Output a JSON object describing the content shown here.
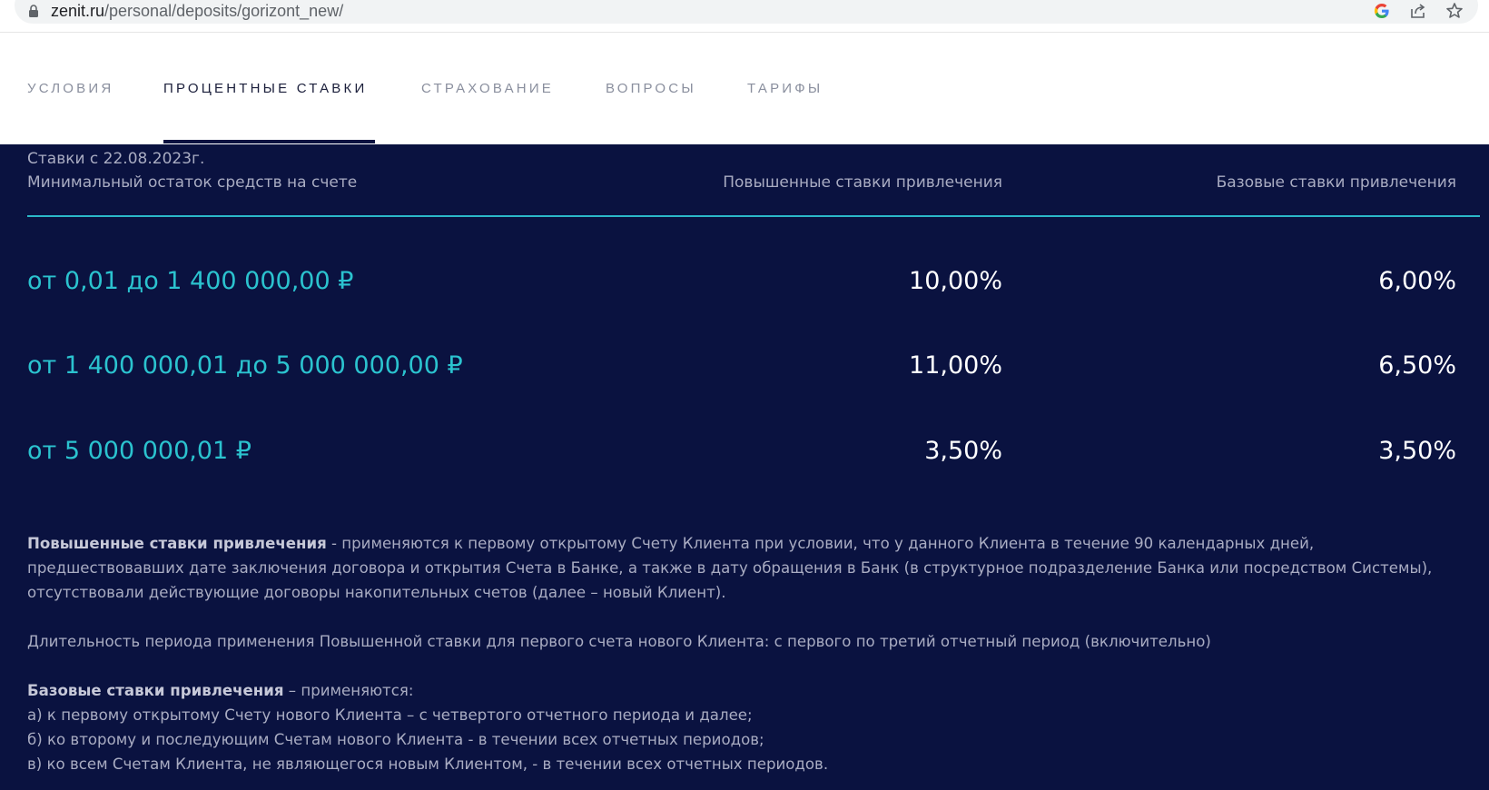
{
  "browser": {
    "url_host": "zenit.ru",
    "url_path": "/personal/deposits/gorizont_new/",
    "icons": [
      "lock-icon",
      "google-icon",
      "share-icon",
      "star-icon"
    ]
  },
  "tabs": [
    {
      "label": "УСЛОВИЯ",
      "active": false
    },
    {
      "label": "ПРОЦЕНТНЫЕ СТАВКИ",
      "active": true
    },
    {
      "label": "СТРАХОВАНИЕ",
      "active": false
    },
    {
      "label": "ВОПРОСЫ",
      "active": false
    },
    {
      "label": "ТАРИФЫ",
      "active": false
    }
  ],
  "rates": {
    "date_note": "Ставки с 22.08.2023г.",
    "columns": [
      "Минимальный остаток средств на счете",
      "Повышенные ставки привлечения",
      "Базовые ставки привлечения"
    ],
    "rows": [
      {
        "range": "от 0,01 до 1 400 000,00 ₽",
        "high": "10,00%",
        "base": "6,00%"
      },
      {
        "range": "от 1 400 000,01 до 5 000 000,00 ₽",
        "high": "11,00%",
        "base": "6,50%"
      },
      {
        "range": "от 5 000 000,01 ₽",
        "high": "3,50%",
        "base": "3,50%"
      }
    ]
  },
  "notes": {
    "p1_bold": "Повышенные ставки привлечения",
    "p1_text": " - применяются к первому открытому Счету Клиента при условии, что у данного Клиента в течение 90 календарных дней, предшествовавших дате заключения договора и открытия Счета в Банке, а также в дату обращения в Банк (в структурное подразделение Банка или посредством Системы), отсутствовали действующие договоры накопительных счетов (далее – новый Клиент).",
    "p2_text": "Длительность периода применения Повышенной ставки для первого счета нового Клиента: с первого по третий отчетный период (включительно)",
    "p3_bold": "Базовые ставки привлечения",
    "p3_text": " – применяются:",
    "p3_items": [
      "а) к первому открытому Счету нового Клиента – с четвертого отчетного периода и далее;",
      "б) ко второму и последующим Счетам нового Клиента - в течении всех отчетных периодов;",
      "в) ко всем Счетам Клиента, не являющегося новым Клиентом, - в течении всех отчетных периодов."
    ]
  },
  "colors": {
    "background_dark": "#0a1240",
    "accent_teal": "#2bc3cf",
    "muted_text": "#a9acc2"
  }
}
